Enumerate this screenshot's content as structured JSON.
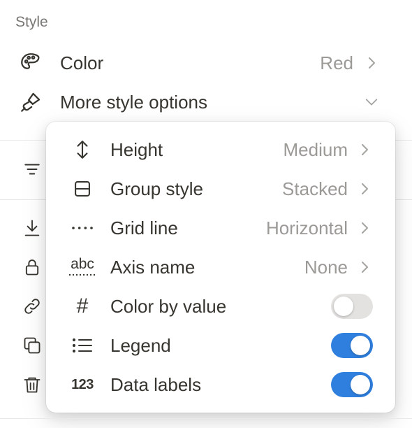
{
  "style_section": {
    "label": "Style",
    "color": {
      "label": "Color",
      "value": "Red",
      "icon": "palette-icon"
    },
    "more_options": {
      "label": "More style options",
      "icon": "paintbrush-icon"
    }
  },
  "background_icons": [
    "filter-icon",
    "download-icon",
    "lock-icon",
    "link-icon",
    "duplicate-icon",
    "trash-icon"
  ],
  "popup": {
    "items": [
      {
        "label": "Height",
        "value": "Medium",
        "icon": "arrows-vertical-icon",
        "type": "select"
      },
      {
        "label": "Group style",
        "value": "Stacked",
        "icon": "split-square-icon",
        "type": "select"
      },
      {
        "label": "Grid line",
        "value": "Horizontal",
        "icon": "dotted-line-icon",
        "type": "select"
      },
      {
        "label": "Axis name",
        "value": "None",
        "icon": "abc-icon",
        "icon_text": "abc",
        "type": "select"
      },
      {
        "label": "Color by value",
        "icon": "hash-icon",
        "icon_text": "#",
        "type": "toggle",
        "enabled": false
      },
      {
        "label": "Legend",
        "icon": "list-icon",
        "type": "toggle",
        "enabled": true
      },
      {
        "label": "Data labels",
        "icon": "numbers-icon",
        "icon_text": "123",
        "type": "toggle",
        "enabled": true
      }
    ]
  },
  "colors": {
    "text": "#37352f",
    "muted": "#9b9a97",
    "toggle_on": "#2f7fde",
    "toggle_off": "#e3e2e0"
  }
}
